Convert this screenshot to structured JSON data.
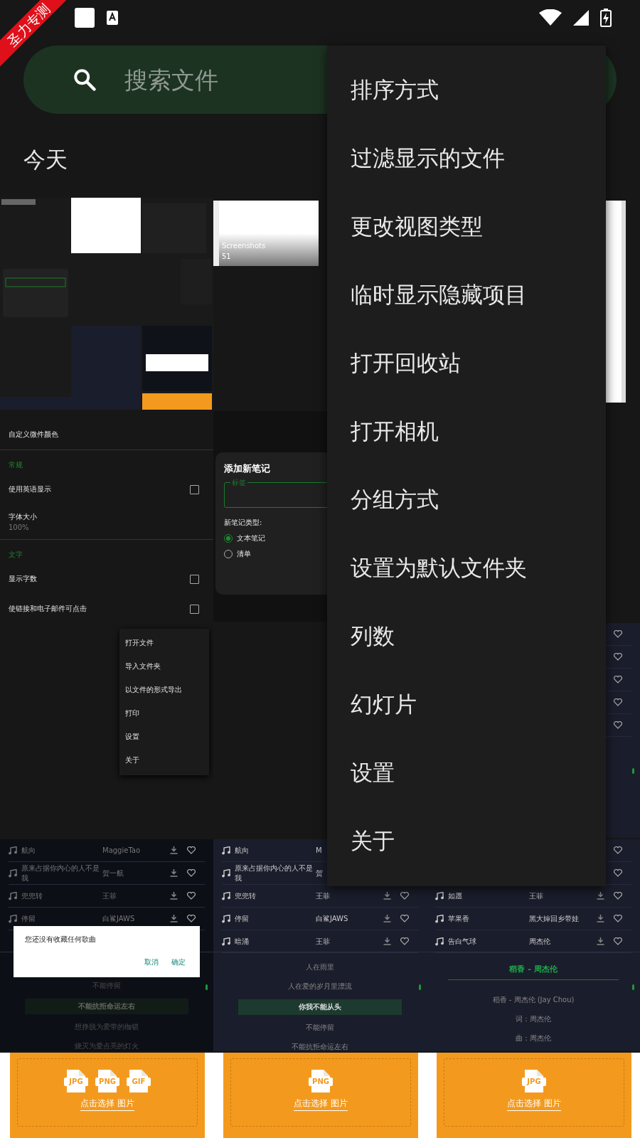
{
  "ribbon": "圣力专测",
  "search": {
    "placeholder": "搜索文件"
  },
  "section_title": "今天",
  "thumbnails": [
    {
      "kind": "gallery"
    },
    {
      "kind": "folder",
      "title": "Screenshots",
      "count": "51"
    },
    {
      "kind": "page"
    },
    {
      "kind": "settings",
      "groups": [
        {
          "items": [
            {
              "title": "自定义微件颜色"
            }
          ]
        },
        {
          "header": "常规",
          "items": [
            {
              "title": "使用英语显示",
              "checked": false
            },
            {
              "title": "字体大小",
              "subtitle": "100%"
            }
          ]
        },
        {
          "header": "文字",
          "items": [
            {
              "title": "显示字数",
              "checked": false
            },
            {
              "title": "使链接和电子邮件可点击",
              "checked": false
            }
          ]
        }
      ]
    },
    {
      "kind": "note_dialog",
      "title": "添加新笔记",
      "field_label": "标签",
      "type_label": "新笔记类型:",
      "options": [
        {
          "label": "文本笔记",
          "selected": true
        },
        {
          "label": "清单",
          "selected": false
        }
      ]
    },
    {
      "kind": "blank"
    },
    {
      "kind": "popup_menu",
      "items": [
        "打开文件",
        "导入文件夹",
        "以文件的形式导出",
        "打印",
        "设置",
        "关于"
      ]
    },
    {
      "kind": "blank"
    },
    {
      "kind": "music",
      "songs": [
        {
          "kind": "right",
          "liked": false
        },
        {
          "kind": "right",
          "liked": false
        },
        {
          "kind": "right",
          "liked": false
        },
        {
          "kind": "right",
          "liked": false
        },
        {
          "kind": "right",
          "liked": false
        }
      ]
    },
    {
      "kind": "music",
      "songs": [
        {
          "kind": "full",
          "title": "航向",
          "artist": "MaggieTao",
          "liked": false
        },
        {
          "kind": "full",
          "title": "原来占据你内心的人不是我",
          "artist": "贺一航",
          "liked": false
        },
        {
          "kind": "full",
          "title": "兜兜转",
          "artist": "王菲",
          "liked": false
        },
        {
          "kind": "full",
          "title": "停留",
          "artist": "白鲨JAWS",
          "liked": false
        }
      ],
      "dialog": {
        "message": "您还没有收藏任何歌曲",
        "buttons": [
          "取消",
          "确定"
        ]
      },
      "lyrics": [
        {
          "text": "不能停留",
          "selected": false
        },
        {
          "text": "不能抗拒命运左右",
          "selected": true
        },
        {
          "text": "想挣脱为爱带的枷锁",
          "selected": false
        },
        {
          "text": "烧灭为爱点亮的灯火",
          "selected": false
        }
      ]
    },
    {
      "kind": "music",
      "songs": [
        {
          "kind": "left",
          "title": "航向",
          "artist": "M"
        },
        {
          "kind": "left",
          "title": "原来占据你内心的人不是我",
          "artist": "贺"
        },
        {
          "kind": "full",
          "title": "兜兜转",
          "artist": "王菲",
          "liked": false
        },
        {
          "kind": "full",
          "title": "停留",
          "artist": "白鲨JAWS",
          "liked": false
        },
        {
          "kind": "full",
          "title": "暗涌",
          "artist": "王菲",
          "liked": false
        }
      ],
      "lyrics": [
        {
          "text": "人在雨里",
          "selected": false
        },
        {
          "text": "人在爱的岁月里漂流",
          "selected": false
        },
        {
          "text": "你我不能从头",
          "selected": true
        },
        {
          "text": "不能停留",
          "selected": false
        },
        {
          "text": "不能抗拒命运左右",
          "selected": false
        }
      ]
    },
    {
      "kind": "music",
      "songs": [
        {
          "kind": "right",
          "liked": false
        },
        {
          "kind": "right",
          "liked": false
        },
        {
          "kind": "full",
          "title": "如愿",
          "artist": "王菲",
          "liked": false
        },
        {
          "kind": "full",
          "title": "苹果香",
          "artist": "黑大婶回乡带娃",
          "liked": false
        },
        {
          "kind": "full",
          "title": "告白气球",
          "artist": "周杰伦",
          "liked": false
        }
      ],
      "lyrics_title": "稻香 - 周杰伦",
      "lyrics": [
        {
          "text": "稻香 - 周杰伦 (Jay Chou)",
          "selected": false
        },
        {
          "text": "词：周杰伦",
          "selected": false
        },
        {
          "text": "曲：周杰伦",
          "selected": false
        }
      ]
    },
    {
      "kind": "upload",
      "formats": [
        "JPG",
        "PNG",
        "GIF"
      ],
      "link": "点击选择 图片"
    },
    {
      "kind": "upload",
      "formats": [
        "PNG"
      ],
      "link": "点击选择 图片"
    },
    {
      "kind": "upload",
      "formats": [
        "JPG"
      ],
      "link": "点击选择 图片"
    }
  ],
  "overflow_menu": {
    "items": [
      "排序方式",
      "过滤显示的文件",
      "更改视图类型",
      "临时显示隐藏项目",
      "打开回收站",
      "打开相机",
      "分组方式",
      "设置为默认文件夹",
      "列数",
      "幻灯片",
      "设置",
      "关于"
    ]
  }
}
